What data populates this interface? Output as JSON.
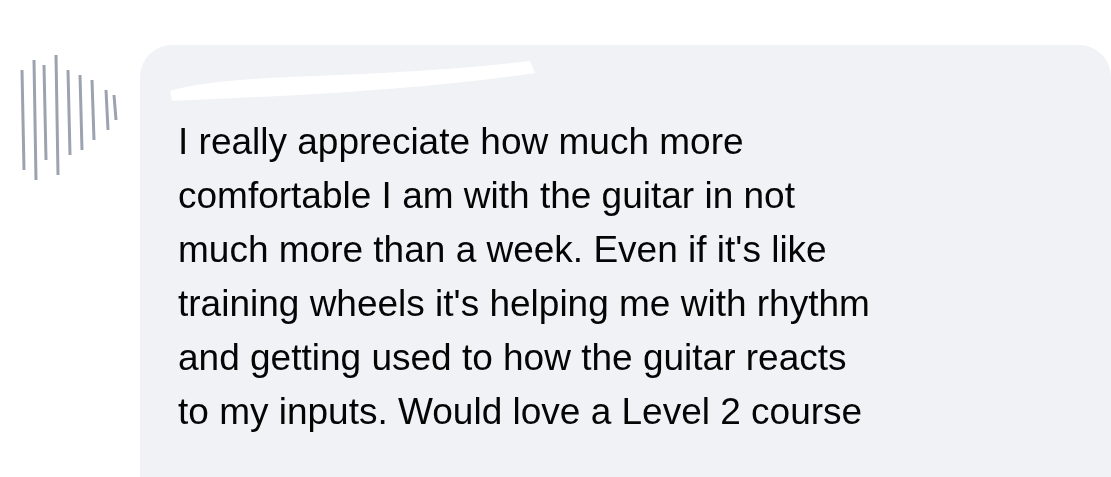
{
  "comment": {
    "text_lines": [
      "I really appreciate how much more",
      "comfortable I am with the guitar in not",
      "much more than a week. Even if it's like",
      "training wheels it's helping me with rhythm",
      "and getting used to how the guitar reacts",
      "to my inputs. Would love a Level 2 course"
    ]
  }
}
